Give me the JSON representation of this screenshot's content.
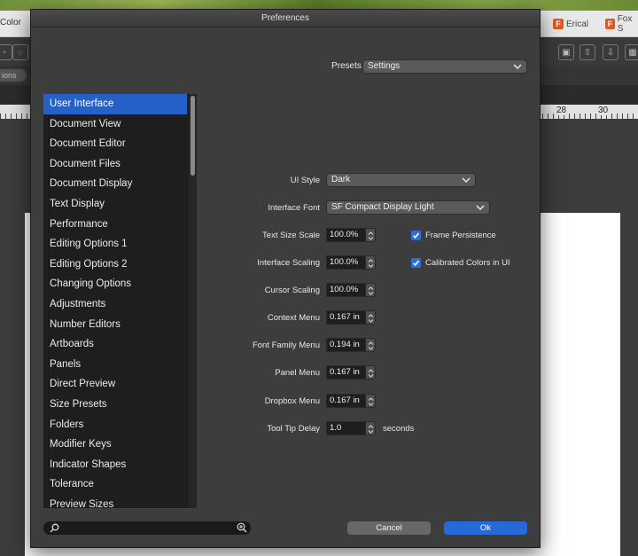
{
  "background": {
    "left_label": "Color",
    "tabs": [
      {
        "icon": "F",
        "label": "Erical"
      },
      {
        "icon": "F",
        "label": "Fox S"
      }
    ],
    "options_label": "ions",
    "ruler_numbers": [
      "28",
      "30"
    ]
  },
  "dialog": {
    "title": "Preferences",
    "presets": {
      "label": "Presets",
      "value": "Settings"
    },
    "sidebar": {
      "items": [
        "User Interface",
        "Document View",
        "Document Editor",
        "Document Files",
        "Document Display",
        "Text Display",
        "Performance",
        "Editing Options 1",
        "Editing Options 2",
        "Changing Options",
        "Adjustments",
        "Number Editors",
        "Artboards",
        "Panels",
        "Direct Preview",
        "Size Presets",
        "Folders",
        "Modifier Keys",
        "Indicator Shapes",
        "Tolerance",
        "Preview Sizes"
      ],
      "selected_index": 0
    },
    "ui_style": {
      "label": "UI Style",
      "value": "Dark"
    },
    "interface_font": {
      "label": "Interface Font",
      "value": "SF Compact Display Light"
    },
    "settings": [
      {
        "label": "Text Size Scale",
        "value": "100.0%"
      },
      {
        "label": "Interface Scaling",
        "value": "100.0%"
      },
      {
        "label": "Cursor Scaling",
        "value": "100.0%"
      },
      {
        "label": "Context Menu",
        "value": "0.167 in"
      },
      {
        "label": "Font Family Menu",
        "value": "0.194 in"
      },
      {
        "label": "Panel Menu",
        "value": "0.167 in"
      },
      {
        "label": "Dropbox Menu",
        "value": "0.167 in"
      },
      {
        "label": "Tool Tip Delay",
        "value": "1.0",
        "unit": "seconds"
      }
    ],
    "checkboxes": [
      {
        "label": "Frame Persistence",
        "checked": true
      },
      {
        "label": "Calibrated Colors in UI",
        "checked": true
      }
    ],
    "buttons": {
      "cancel": "Cancel",
      "ok": "Ok"
    },
    "colors": {
      "accent": "#2561c9",
      "dialog_bg": "#3d3d3d",
      "list_bg": "#1e1e1e"
    }
  }
}
